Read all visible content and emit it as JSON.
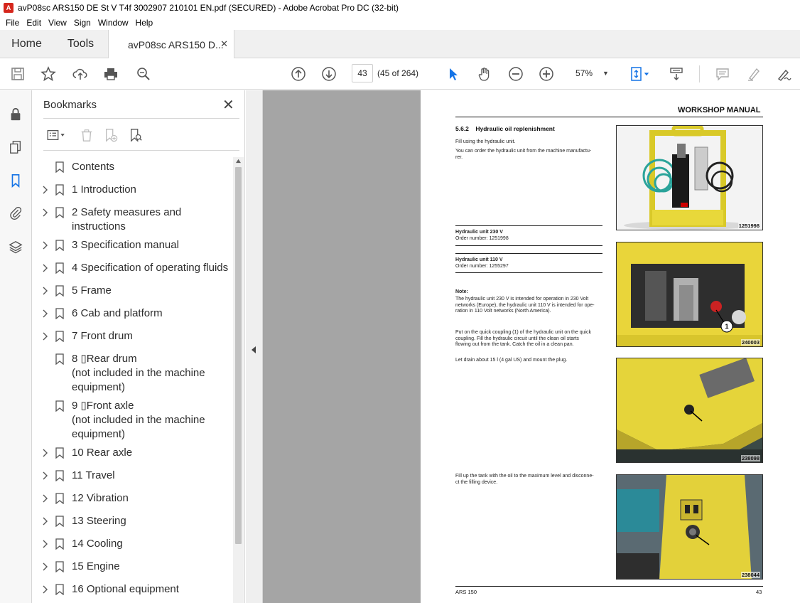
{
  "window": {
    "title": "avP08sc ARS150 DE St V T4f 3002907 210101 EN.pdf (SECURED) - Adobe Acrobat Pro DC (32-bit)",
    "app_icon_letter": "A"
  },
  "menu": [
    "File",
    "Edit",
    "View",
    "Sign",
    "Window",
    "Help"
  ],
  "tabs": {
    "home": "Home",
    "tools": "Tools",
    "document": "avP08sc ARS150 D...",
    "close": "✕"
  },
  "toolbar": {
    "page_current": "43",
    "page_count": "(45 of 264)",
    "zoom": "57%",
    "zoom_caret": "▼"
  },
  "bookmarks": {
    "title": "Bookmarks",
    "close": "✕",
    "items": [
      {
        "label": "Contents",
        "expandable": false
      },
      {
        "label": "1 Introduction",
        "expandable": true
      },
      {
        "label": "2 Safety measures and\ninstructions",
        "expandable": true
      },
      {
        "label": "3 Specification manual",
        "expandable": true
      },
      {
        "label": "4 Specification of operating fluids",
        "expandable": true
      },
      {
        "label": "5 Frame",
        "expandable": true
      },
      {
        "label": "6 Cab and platform",
        "expandable": true
      },
      {
        "label": "7 Front drum",
        "expandable": true
      },
      {
        "label": "8 ▯Rear drum\n(not included in the machine\nequipment)",
        "expandable": false
      },
      {
        "label": "9 ▯Front axle\n(not included in the machine\nequipment)",
        "expandable": false
      },
      {
        "label": "10 Rear axle",
        "expandable": true
      },
      {
        "label": "11 Travel",
        "expandable": true
      },
      {
        "label": "12 Vibration",
        "expandable": true
      },
      {
        "label": "13 Steering",
        "expandable": true
      },
      {
        "label": "14 Cooling",
        "expandable": true
      },
      {
        "label": "15 Engine",
        "expandable": true
      },
      {
        "label": "16 Optional equipment",
        "expandable": true
      }
    ]
  },
  "page": {
    "header": "WORKSHOP MANUAL",
    "section": "5.6.2    Hydraulic oil replenishment",
    "intro_1": "Fill using the hydraulic unit.",
    "intro_2": "You can order the hydraulic unit from the machine manufactu-\nrer.",
    "unit230_title": "Hydraulic unit 230 V",
    "unit230_order": "Order number: 1251998",
    "unit110_title": "Hydraulic unit 110 V",
    "unit110_order": "Order number: 1255297",
    "note_title": "Note:",
    "note_text": "The hydraulic unit 230 V is intended for operation in 230 Volt\nnetworks (Europe), the hydraulic unit 110 V is intended for ope-\nration in 110 Volt networks (North America).",
    "step_1": "Put on the quick coupling (1) of the hydraulic unit on the quick\ncoupling. Fill the hydraulic circuit until the clean oil starts\nflowing out from the tank. Catch the oil in a clean pan.",
    "step_2": "Let drain about 15 l (4 gal US) and mount the plug.",
    "step_3": "Fill up the tank with the oil to the maximum level and disconne-\nct the filling device.",
    "photo_codes": [
      "1251998",
      "240003",
      "238098",
      "238044"
    ],
    "callout": "1",
    "footer_left": "ARS 150",
    "footer_right": "43"
  },
  "colors": {
    "accent_blue": "#1473e6",
    "doc_gray": "#a5a5a5",
    "machine_yellow": "#e8d83a"
  }
}
